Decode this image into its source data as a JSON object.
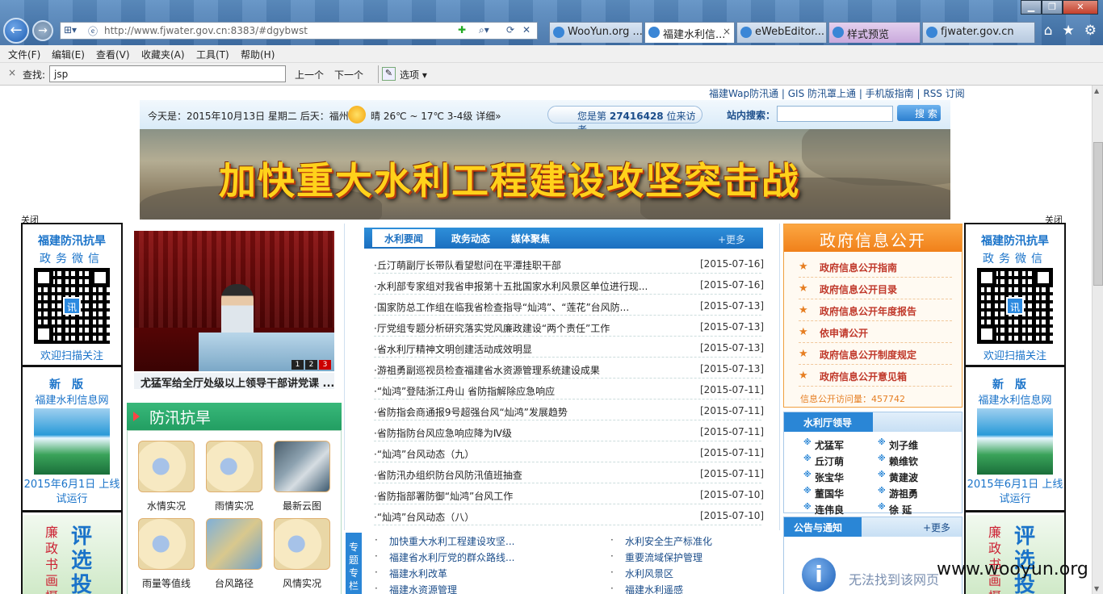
{
  "browser": {
    "url": "http://www.fjwater.gov.cn:8383/#dgybwst",
    "tabs": [
      "WooYun.org ...",
      "福建水利信...",
      "eWebEditor...",
      "样式预览",
      "fjwater.gov.cn"
    ],
    "tab_close": "×",
    "menu": [
      "文件(F)",
      "编辑(E)",
      "查看(V)",
      "收藏夹(A)",
      "工具(T)",
      "帮助(H)"
    ],
    "find": {
      "close": "×",
      "label": "查找:",
      "value": "jsp",
      "prev": "上一个",
      "next": "下一个",
      "options": "选项"
    }
  },
  "page": {
    "top_links": "福建Wap防汛通 | GIS 防汛罩上通 | 手机版指南 | RSS 订阅",
    "date_line": "今天是：2015年10月13日 星期二 后天：福州",
    "weather": "晴 26℃ ~ 17℃ 3-4级 详细»",
    "visitor_prefix": "您是第",
    "visitor_count": "27416428",
    "visitor_suffix": "位来访者",
    "search_label": "站内搜索：",
    "search_button": "搜 索",
    "banner_title": "加快重大水利工程建设攻坚突击战",
    "close": "关闭",
    "side_ad": {
      "title": "福建防汛抗旱",
      "subtitle": "政务微信",
      "qr_mark": "讯",
      "scan": "欢迎扫描关注",
      "new": "新版",
      "site": "福建水利信息网",
      "launch": "2015年6月1日 上线试运行",
      "bottom_left": "廉政书画摄",
      "bottom_right": "评选投"
    },
    "photo_caption": "尤猛军给全厅处级以上领导干部讲党课 ...",
    "photo_pages": [
      "1",
      "2",
      "3"
    ],
    "flood": {
      "title": "防汛抗旱",
      "items": [
        "水情实况",
        "雨情实况",
        "最新云图",
        "雨量等值线",
        "台风路径",
        "风情实况"
      ]
    },
    "news": {
      "tabs": [
        "水利要闻",
        "政务动态",
        "媒体聚焦"
      ],
      "more": "+更多",
      "items": [
        {
          "title": "·丘汀萌副厅长带队看望慰问在平潭挂职干部",
          "date": "[2015-07-16]"
        },
        {
          "title": "·水利部专家组对我省申报第十五批国家水利风景区单位进行现...",
          "date": "[2015-07-16]"
        },
        {
          "title": "·国家防总工作组在临我省检查指导“灿鸿”、“莲花”台风防...",
          "date": "[2015-07-13]"
        },
        {
          "title": "·厅党组专题分析研究落实党风廉政建设“两个责任”工作",
          "date": "[2015-07-13]"
        },
        {
          "title": "·省水利厅精神文明创建活动成效明显",
          "date": "[2015-07-13]"
        },
        {
          "title": "·游祖勇副巡视员检查福建省水资源管理系统建设成果",
          "date": "[2015-07-13]"
        },
        {
          "title": "·“灿鸿”登陆浙江舟山 省防指解除应急响应",
          "date": "[2015-07-11]"
        },
        {
          "title": "·省防指会商通报9号超强台风“灿鸿”发展趋势",
          "date": "[2015-07-11]"
        },
        {
          "title": "·省防指防台风应急响应降为Ⅳ级",
          "date": "[2015-07-11]"
        },
        {
          "title": "·“灿鸿”台风动态（九）",
          "date": "[2015-07-11]"
        },
        {
          "title": "·省防汛办组织防台风防汛值班抽查",
          "date": "[2015-07-11]"
        },
        {
          "title": "·省防指部署防御“灿鸿”台风工作",
          "date": "[2015-07-10]"
        },
        {
          "title": "·“灿鸿”台风动态（八）",
          "date": "[2015-07-10]"
        }
      ]
    },
    "special": {
      "label": "专题专栏",
      "left": [
        "加快重大水利工程建设攻坚...",
        "福建省水利厅党的群众路线...",
        "福建水利改革",
        "福建水资源管理"
      ],
      "right": [
        "水利安全生产标准化",
        "重要流域保护管理",
        "水利风景区",
        "福建水利遥感"
      ]
    },
    "gov": {
      "title": "政府信息公开",
      "star": "★",
      "items": [
        "政府信息公开指南",
        "政府信息公开目录",
        "政府信息公开年度报告",
        "依申请公开",
        "政府信息公开制度规定",
        "政府信息公开意见箱"
      ],
      "visits": "信息公开访问量：457742"
    },
    "leaders": {
      "title": "水利厅领导",
      "names": [
        "尤猛军",
        "刘子维",
        "丘汀萌",
        "赖维钦",
        "张宝华",
        "黄建波",
        "董国华",
        "游祖勇",
        "连伟良",
        "徐 延"
      ]
    },
    "notice": {
      "title": "公告与通知",
      "more": "+更多",
      "error": "无法找到该网页",
      "icon": "i"
    }
  },
  "watermark": "www.wooyun.org"
}
